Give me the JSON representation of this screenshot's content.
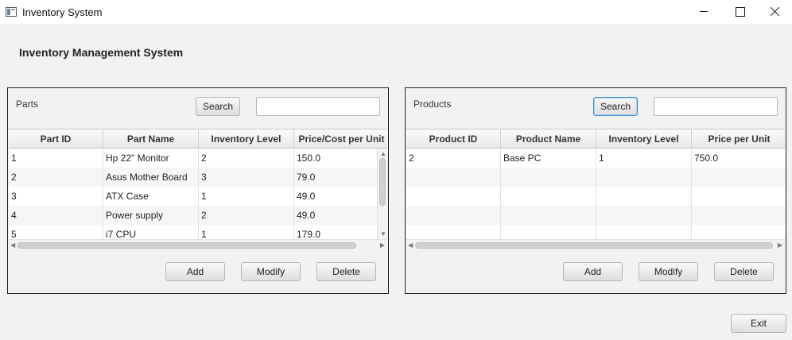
{
  "window": {
    "title": "Inventory System",
    "icon": "app-window-icon",
    "controls": [
      "minimize-icon",
      "maximize-icon",
      "close-icon"
    ]
  },
  "main_title": "Inventory Management System",
  "parts": {
    "label": "Parts",
    "search_label": "Search",
    "search_value": "",
    "columns": [
      "Part ID",
      "Part Name",
      "Inventory Level",
      "Price/Cost per Unit"
    ],
    "rows": [
      [
        "1",
        "Hp 22\" Monitor",
        "2",
        "150.0"
      ],
      [
        "2",
        "Asus Mother Board",
        "3",
        "79.0"
      ],
      [
        "3",
        "ATX Case",
        "1",
        "49.0"
      ],
      [
        "4",
        "Power supply",
        "2",
        "49.0"
      ],
      [
        "5",
        "i7 CPU",
        "1",
        "179.0"
      ]
    ],
    "add_label": "Add",
    "modify_label": "Modify",
    "delete_label": "Delete"
  },
  "products": {
    "label": "Products",
    "search_label": "Search",
    "search_value": "",
    "columns": [
      "Product ID",
      "Product Name",
      "Inventory Level",
      "Price per Unit"
    ],
    "rows": [
      [
        "2",
        "Base PC",
        "1",
        "750.0"
      ],
      [
        "",
        "",
        "",
        ""
      ],
      [
        "",
        "",
        "",
        ""
      ],
      [
        "",
        "",
        "",
        ""
      ],
      [
        "",
        "",
        "",
        ""
      ]
    ],
    "add_label": "Add",
    "modify_label": "Modify",
    "delete_label": "Delete"
  },
  "exit_label": "Exit",
  "colors": {
    "background": "#f2f2f2",
    "focus_border": "#3c8fd4",
    "panel_border": "#222222"
  }
}
